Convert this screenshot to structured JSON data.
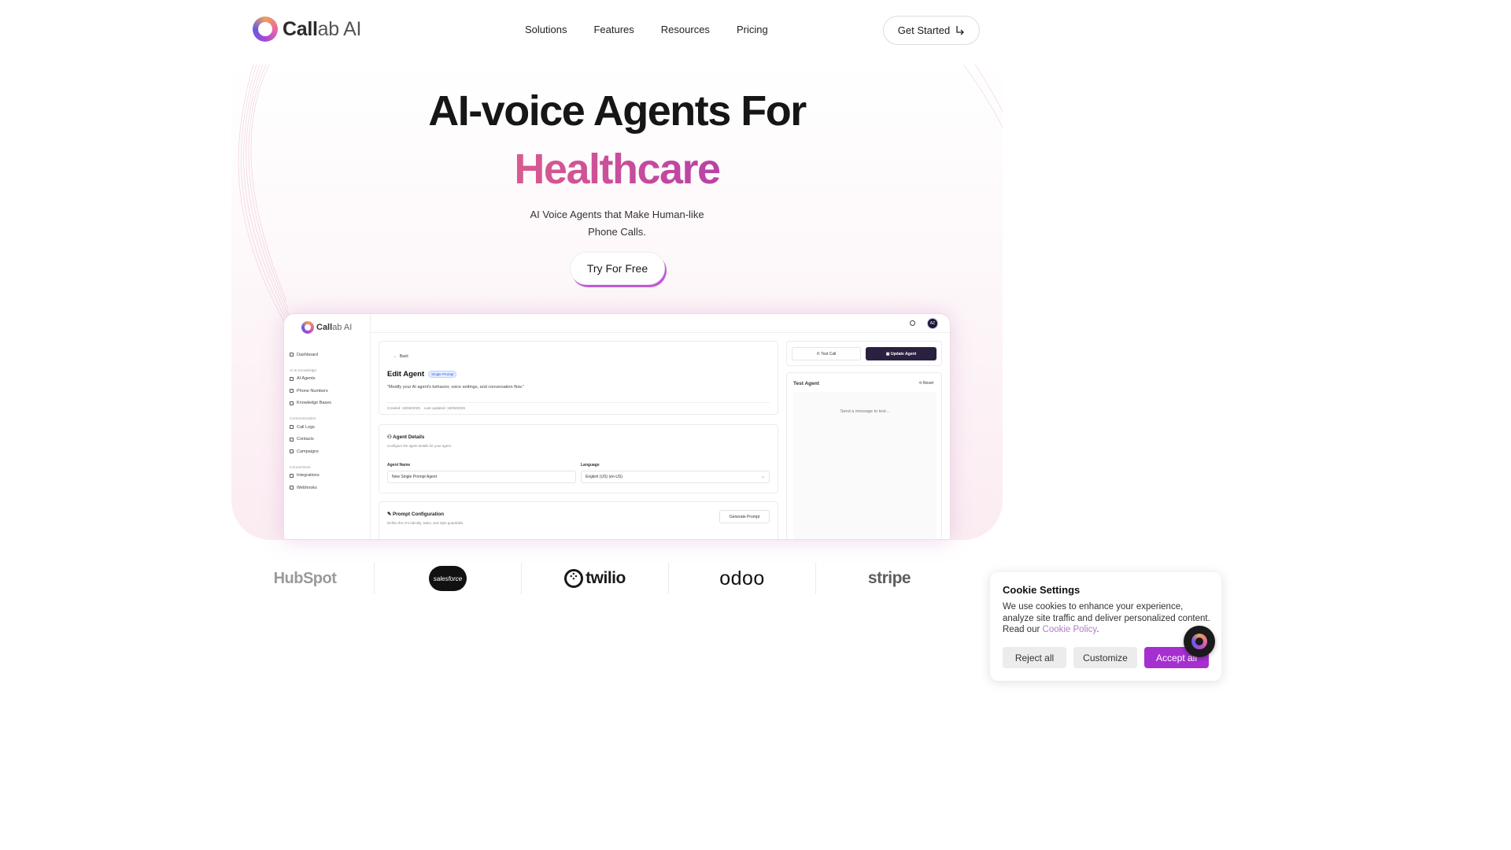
{
  "brand": {
    "name_bold": "Call",
    "name_light": "ab AI"
  },
  "nav": {
    "links": [
      "Solutions",
      "Features",
      "Resources",
      "Pricing"
    ],
    "cta": "Get Started",
    "cta_icon": "arrow-corner-down-right-icon"
  },
  "hero": {
    "title_line1": "AI-voice Agents For",
    "title_line2": "Healthcare",
    "subtitle": "AI Voice Agents that Make Human-like Phone Calls.",
    "cta": "Try For Free"
  },
  "mockup": {
    "brand_bold": "Call",
    "brand_light": "ab AI",
    "avatar": "AZ",
    "sidebar": {
      "dashboard": "Dashboard",
      "section1": "AI & Knowledge",
      "ai_agents": "AI Agents",
      "phone_numbers": "Phone Numbers",
      "knowledge_bases": "Knowledge Bases",
      "section2": "Communication",
      "call_logs": "Call Logs",
      "contacts": "Contacts",
      "campaigns": "Campaigns",
      "section3": "Connections",
      "integrations": "Integrations",
      "webhooks": "Webhooks"
    },
    "back": "Back",
    "edit_title": "Edit Agent",
    "edit_badge": "Single Prompt",
    "edit_desc": "\"Modify your AI agent's behavior, voice settings, and conversation flow.\"",
    "created": "Created: 18/06/2025",
    "updated": "Last updated: 18/06/2025",
    "details_title": "Agent Details",
    "details_desc": "Configure the agent details for your agent.",
    "agent_name_label": "Agent Name",
    "agent_name_value": "New Single Prompt Agent",
    "language_label": "Language",
    "language_value": "English (US) (en-US)",
    "prompt_title": "Prompt Configuration",
    "prompt_desc": "Define the AI's identity, tasks, and style guardrails.",
    "generate_prompt": "Generate Prompt",
    "test_call": "Test Call",
    "update_agent": "Update Agent",
    "test_agent": "Test Agent",
    "reset": "Reset",
    "test_placeholder": "Send a message to test..."
  },
  "partners": [
    "HubSpot",
    "salesforce",
    "twilio",
    "odoo",
    "stripe"
  ],
  "cookie": {
    "title": "Cookie Settings",
    "text": "We use cookies to enhance your experience, analyze site traffic and deliver personalized content. Read our ",
    "link": "Cookie Policy",
    "text_end": ".",
    "reject": "Reject all",
    "customize": "Customize",
    "accept": "Accept all"
  },
  "colors": {
    "accent": "#a62fd0",
    "gradient_start": "#e8944f",
    "gradient_end": "#6a148c",
    "dark_button": "#2a2040"
  }
}
